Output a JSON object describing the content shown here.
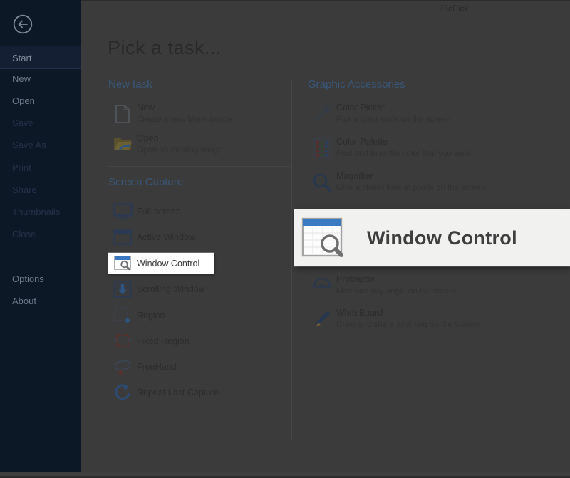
{
  "window": {
    "title": "PicPick"
  },
  "colors": {
    "dim_background": "#3b3b3b",
    "sidebar_bg": "#0d1826",
    "section_header_blue": "#385779",
    "accent_blue": "#3a78c2",
    "highlight_bg": "#ffffff",
    "callout_bg": "#f1f1f0"
  },
  "sidebar": {
    "items": [
      {
        "label": "Start",
        "state": "selected"
      },
      {
        "label": "New",
        "state": "enabled"
      },
      {
        "label": "Open",
        "state": "enabled"
      },
      {
        "label": "Save",
        "state": "disabled"
      },
      {
        "label": "Save As",
        "state": "disabled"
      },
      {
        "label": "Print",
        "state": "disabled"
      },
      {
        "label": "Share",
        "state": "disabled"
      },
      {
        "label": "Thumbnails",
        "state": "disabled"
      },
      {
        "label": "Close",
        "state": "disabled"
      },
      {
        "label": "Options",
        "state": "enabled"
      },
      {
        "label": "About",
        "state": "enabled"
      }
    ]
  },
  "main": {
    "heading": "Pick a task...",
    "sections": {
      "new_task": {
        "title": "New task",
        "items": [
          {
            "label": "New",
            "description": "Create a new blank image",
            "icon": "new-document-icon"
          },
          {
            "label": "Open",
            "description": "Open an existing image",
            "icon": "open-folder-icon"
          }
        ]
      },
      "screen_capture": {
        "title": "Screen Capture",
        "items": [
          {
            "label": "Full-screen",
            "icon": "monitor-icon"
          },
          {
            "label": "Active Window",
            "icon": "window-icon"
          },
          {
            "label": "Window Control",
            "icon": "window-magnifier-icon",
            "highlighted": true
          },
          {
            "label": "Scrolling Window",
            "icon": "scrolling-window-icon"
          },
          {
            "label": "Region",
            "icon": "region-icon"
          },
          {
            "label": "Fixed Region",
            "icon": "fixed-region-icon"
          },
          {
            "label": "FreeHand",
            "icon": "freehand-icon"
          },
          {
            "label": "Repeat Last Capture",
            "icon": "repeat-icon"
          }
        ]
      },
      "graphic_accessories": {
        "title": "Graphic Accessories",
        "items": [
          {
            "label": "Color Picker",
            "description": "Pick a color code on the screen",
            "icon": "eyedropper-icon"
          },
          {
            "label": "Color Palette",
            "description": "Find and tune the color that you want",
            "icon": "palette-icon"
          },
          {
            "label": "Magnifier",
            "description": "Give a closer look at pixels on the screen",
            "icon": "magnifier-icon"
          },
          {
            "label": "Protractor",
            "description": "Measure any angle on the screen",
            "icon": "protractor-icon"
          },
          {
            "label": "WhiteBoard",
            "description": "Draw and share anything on the screen",
            "icon": "whiteboard-pen-icon"
          }
        ]
      }
    }
  },
  "callout": {
    "label": "Window Control"
  }
}
